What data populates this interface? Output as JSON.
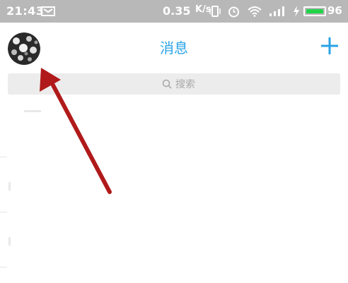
{
  "status_bar": {
    "time": "21:43",
    "network_speed": "0.35",
    "network_speed_unit": "K/s",
    "battery_level": "96",
    "icons": [
      "sim-icon",
      "vibrate-icon",
      "alarm-icon",
      "wifi-icon",
      "signal-icon",
      "charge-icon",
      "battery-icon"
    ],
    "battery_fill_color": "#22d34a"
  },
  "header": {
    "title": "消息",
    "title_color": "#29a3e6",
    "left_icon": "avatar",
    "right_icon": "add-icon"
  },
  "search": {
    "label": "搜索",
    "icon": "search-icon"
  },
  "annotation": {
    "type": "arrow",
    "color": "#b01a1a",
    "points_to": "avatar"
  }
}
